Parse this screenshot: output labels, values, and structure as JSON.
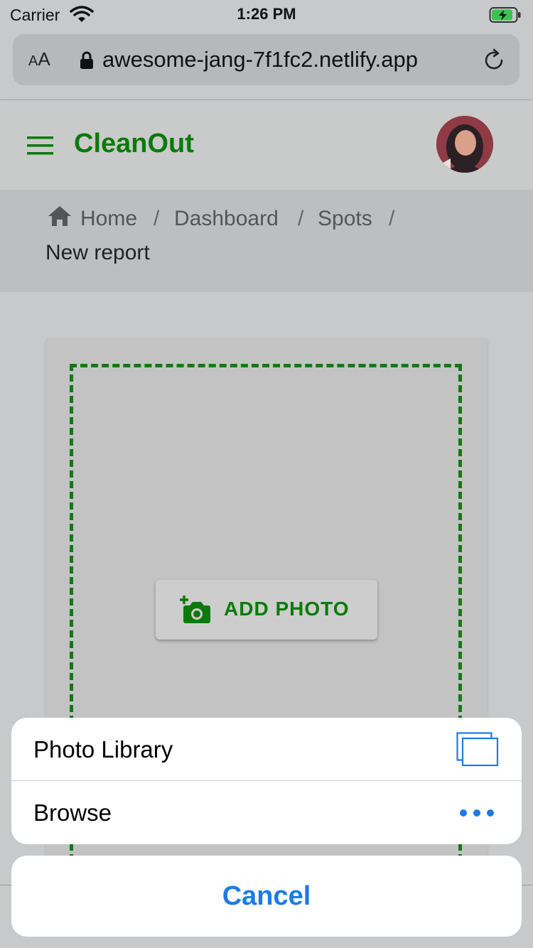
{
  "status_bar": {
    "carrier": "Carrier",
    "time": "1:26 PM"
  },
  "browser": {
    "text_size_label_small": "A",
    "text_size_label_large": "A",
    "url": "awesome-jang-7f1fc2.netlify.app"
  },
  "app_bar": {
    "brand": "CleanOut"
  },
  "breadcrumb": {
    "items": [
      "Home",
      "Dashboard",
      "Spots"
    ],
    "separator": "/",
    "current": "New report"
  },
  "card": {
    "add_photo_label": "ADD PHOTO"
  },
  "action_sheet": {
    "options": [
      "Photo Library",
      "Browse"
    ],
    "cancel_label": "Cancel"
  },
  "colors": {
    "brand_green": "#0b7a0b",
    "ios_blue": "#1b7ce5"
  }
}
